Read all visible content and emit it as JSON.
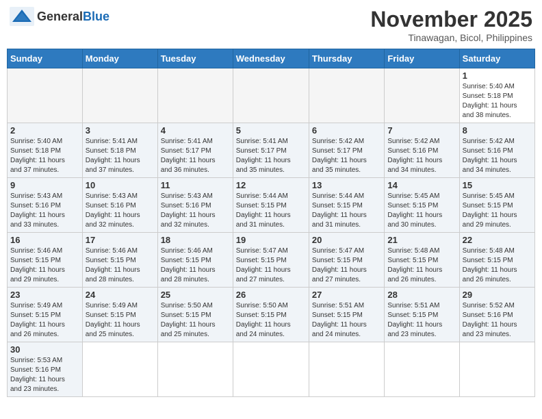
{
  "header": {
    "logo_text_general": "General",
    "logo_text_blue": "Blue",
    "month_title": "November 2025",
    "subtitle": "Tinawagan, Bicol, Philippines"
  },
  "weekdays": [
    "Sunday",
    "Monday",
    "Tuesday",
    "Wednesday",
    "Thursday",
    "Friday",
    "Saturday"
  ],
  "weeks": [
    [
      {
        "day": "",
        "info": ""
      },
      {
        "day": "",
        "info": ""
      },
      {
        "day": "",
        "info": ""
      },
      {
        "day": "",
        "info": ""
      },
      {
        "day": "",
        "info": ""
      },
      {
        "day": "",
        "info": ""
      },
      {
        "day": "1",
        "info": "Sunrise: 5:40 AM\nSunset: 5:18 PM\nDaylight: 11 hours\nand 38 minutes."
      }
    ],
    [
      {
        "day": "2",
        "info": "Sunrise: 5:40 AM\nSunset: 5:18 PM\nDaylight: 11 hours\nand 37 minutes."
      },
      {
        "day": "3",
        "info": "Sunrise: 5:41 AM\nSunset: 5:18 PM\nDaylight: 11 hours\nand 37 minutes."
      },
      {
        "day": "4",
        "info": "Sunrise: 5:41 AM\nSunset: 5:17 PM\nDaylight: 11 hours\nand 36 minutes."
      },
      {
        "day": "5",
        "info": "Sunrise: 5:41 AM\nSunset: 5:17 PM\nDaylight: 11 hours\nand 35 minutes."
      },
      {
        "day": "6",
        "info": "Sunrise: 5:42 AM\nSunset: 5:17 PM\nDaylight: 11 hours\nand 35 minutes."
      },
      {
        "day": "7",
        "info": "Sunrise: 5:42 AM\nSunset: 5:16 PM\nDaylight: 11 hours\nand 34 minutes."
      },
      {
        "day": "8",
        "info": "Sunrise: 5:42 AM\nSunset: 5:16 PM\nDaylight: 11 hours\nand 34 minutes."
      }
    ],
    [
      {
        "day": "9",
        "info": "Sunrise: 5:43 AM\nSunset: 5:16 PM\nDaylight: 11 hours\nand 33 minutes."
      },
      {
        "day": "10",
        "info": "Sunrise: 5:43 AM\nSunset: 5:16 PM\nDaylight: 11 hours\nand 32 minutes."
      },
      {
        "day": "11",
        "info": "Sunrise: 5:43 AM\nSunset: 5:16 PM\nDaylight: 11 hours\nand 32 minutes."
      },
      {
        "day": "12",
        "info": "Sunrise: 5:44 AM\nSunset: 5:15 PM\nDaylight: 11 hours\nand 31 minutes."
      },
      {
        "day": "13",
        "info": "Sunrise: 5:44 AM\nSunset: 5:15 PM\nDaylight: 11 hours\nand 31 minutes."
      },
      {
        "day": "14",
        "info": "Sunrise: 5:45 AM\nSunset: 5:15 PM\nDaylight: 11 hours\nand 30 minutes."
      },
      {
        "day": "15",
        "info": "Sunrise: 5:45 AM\nSunset: 5:15 PM\nDaylight: 11 hours\nand 29 minutes."
      }
    ],
    [
      {
        "day": "16",
        "info": "Sunrise: 5:46 AM\nSunset: 5:15 PM\nDaylight: 11 hours\nand 29 minutes."
      },
      {
        "day": "17",
        "info": "Sunrise: 5:46 AM\nSunset: 5:15 PM\nDaylight: 11 hours\nand 28 minutes."
      },
      {
        "day": "18",
        "info": "Sunrise: 5:46 AM\nSunset: 5:15 PM\nDaylight: 11 hours\nand 28 minutes."
      },
      {
        "day": "19",
        "info": "Sunrise: 5:47 AM\nSunset: 5:15 PM\nDaylight: 11 hours\nand 27 minutes."
      },
      {
        "day": "20",
        "info": "Sunrise: 5:47 AM\nSunset: 5:15 PM\nDaylight: 11 hours\nand 27 minutes."
      },
      {
        "day": "21",
        "info": "Sunrise: 5:48 AM\nSunset: 5:15 PM\nDaylight: 11 hours\nand 26 minutes."
      },
      {
        "day": "22",
        "info": "Sunrise: 5:48 AM\nSunset: 5:15 PM\nDaylight: 11 hours\nand 26 minutes."
      }
    ],
    [
      {
        "day": "23",
        "info": "Sunrise: 5:49 AM\nSunset: 5:15 PM\nDaylight: 11 hours\nand 26 minutes."
      },
      {
        "day": "24",
        "info": "Sunrise: 5:49 AM\nSunset: 5:15 PM\nDaylight: 11 hours\nand 25 minutes."
      },
      {
        "day": "25",
        "info": "Sunrise: 5:50 AM\nSunset: 5:15 PM\nDaylight: 11 hours\nand 25 minutes."
      },
      {
        "day": "26",
        "info": "Sunrise: 5:50 AM\nSunset: 5:15 PM\nDaylight: 11 hours\nand 24 minutes."
      },
      {
        "day": "27",
        "info": "Sunrise: 5:51 AM\nSunset: 5:15 PM\nDaylight: 11 hours\nand 24 minutes."
      },
      {
        "day": "28",
        "info": "Sunrise: 5:51 AM\nSunset: 5:15 PM\nDaylight: 11 hours\nand 23 minutes."
      },
      {
        "day": "29",
        "info": "Sunrise: 5:52 AM\nSunset: 5:16 PM\nDaylight: 11 hours\nand 23 minutes."
      }
    ],
    [
      {
        "day": "30",
        "info": "Sunrise: 5:53 AM\nSunset: 5:16 PM\nDaylight: 11 hours\nand 23 minutes."
      },
      {
        "day": "",
        "info": ""
      },
      {
        "day": "",
        "info": ""
      },
      {
        "day": "",
        "info": ""
      },
      {
        "day": "",
        "info": ""
      },
      {
        "day": "",
        "info": ""
      },
      {
        "day": "",
        "info": ""
      }
    ]
  ]
}
